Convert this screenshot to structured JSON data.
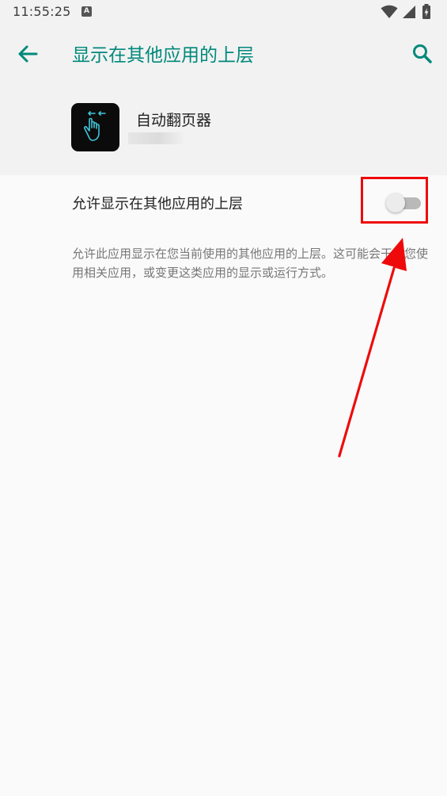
{
  "status_bar": {
    "time": "11:55:25",
    "notification_badge": "A",
    "icons": [
      "wifi-icon",
      "signal-icon",
      "battery-icon"
    ]
  },
  "app_bar": {
    "title": "显示在其他应用的上层",
    "back_icon": "arrow-back-icon",
    "search_icon": "search-icon"
  },
  "app_header": {
    "app_name": "自动翻页器",
    "icon": "hand-swipe-icon"
  },
  "setting": {
    "label": "允许显示在其他应用的上层",
    "enabled": false,
    "description": "允许此应用显示在您当前使用的其他应用的上层。这可能会干扰您使用相关应用，或变更这类应用的显示或运行方式。"
  },
  "colors": {
    "accent": "#00897b",
    "annotation": "#ee0a0a",
    "header_background": "#f2f2f2",
    "page_background": "#fafafa"
  }
}
